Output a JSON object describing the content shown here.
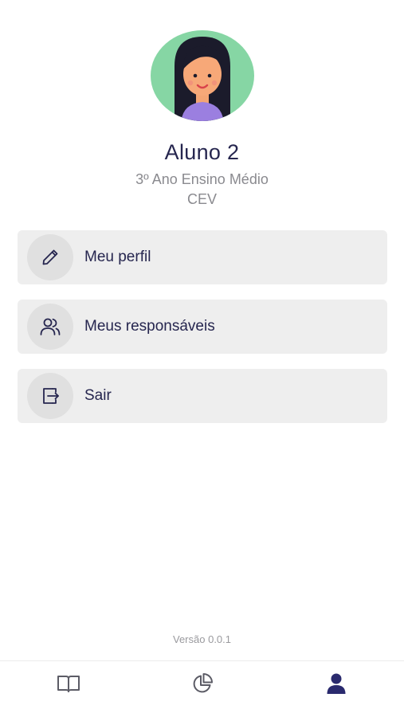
{
  "profile": {
    "name": "Aluno 2",
    "grade": "3º Ano Ensino Médio",
    "school": "CEV"
  },
  "menu": {
    "items": [
      {
        "label": "Meu perfil",
        "icon": "pencil-icon"
      },
      {
        "label": "Meus responsáveis",
        "icon": "users-icon"
      },
      {
        "label": "Sair",
        "icon": "logout-icon"
      }
    ]
  },
  "footer": {
    "version": "Versão 0.0.1"
  },
  "tabbar": {
    "tabs": [
      {
        "icon": "book-icon",
        "active": false
      },
      {
        "icon": "pie-chart-icon",
        "active": false
      },
      {
        "icon": "user-icon",
        "active": true
      }
    ]
  },
  "colors": {
    "primary": "#26264f",
    "avatar_bg": "#86d6a4",
    "menu_bg": "#eeeeee",
    "icon_circle_bg": "#e0e0e0",
    "muted_text": "#8a8a8f",
    "tab_inactive": "#5c5c66",
    "tab_active": "#2a2a6e"
  }
}
